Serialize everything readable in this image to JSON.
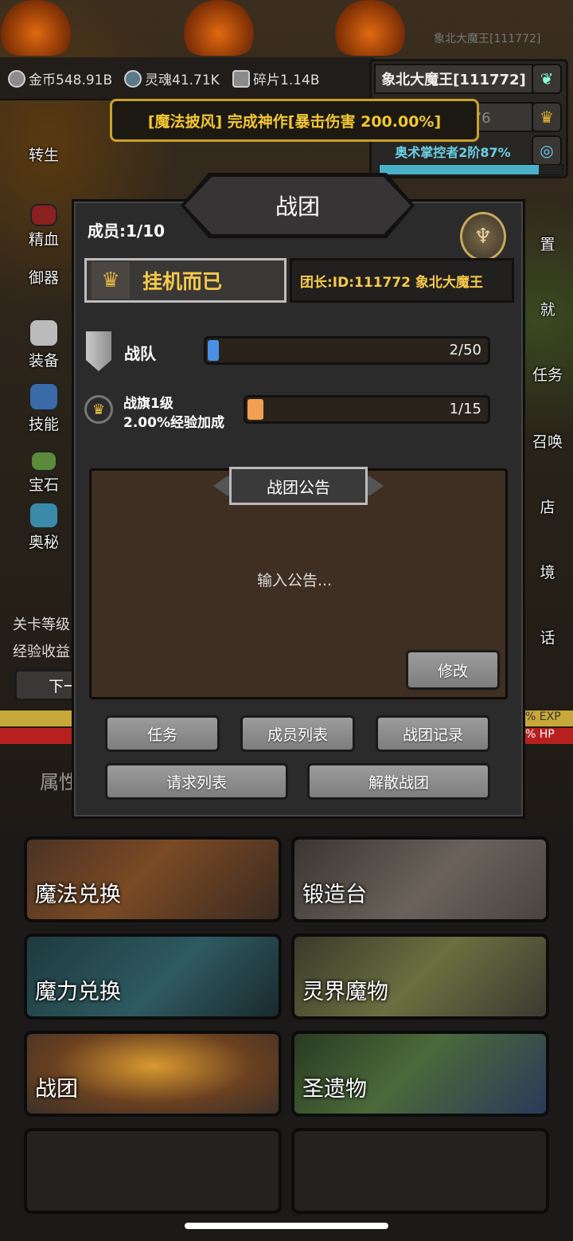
{
  "top": {
    "player_label": "象北大魔王[111772]",
    "resources": [
      {
        "icon": "gold-coin-icon",
        "label": "金币548.91B"
      },
      {
        "icon": "soul-icon",
        "label": "灵魂41.71K"
      },
      {
        "icon": "shard-icon",
        "label": "碎片1.14B"
      }
    ],
    "info_panel": {
      "name": "象北大魔王[111772]",
      "level": "等级13776",
      "skill": "奥术掌控者2阶87%",
      "skill_progress": 0.87
    }
  },
  "banner": "[魔法披风] 完成神作[暴击伤害 200.00%]",
  "left_menu": [
    "转生",
    "精血",
    "御器",
    "装备",
    "技能",
    "宝石",
    "奥秘"
  ],
  "right_menu": [
    "置",
    "就",
    "任务",
    "召唤",
    "店",
    "境",
    "话"
  ],
  "stage_info": {
    "line1": "关卡等级",
    "line2": "经验收益",
    "next": "下一",
    "exp": "% EXP",
    "hp": "% HP",
    "attr": "属性"
  },
  "dialog": {
    "title": "战团",
    "members": "成员:1/10",
    "guild_name": "挂机而已",
    "leader": "团长:ID:111772 象北大魔王",
    "squad": {
      "label": "战队",
      "value_text": "2/50",
      "progress": 0.04,
      "color": "#4b8fe6"
    },
    "flag": {
      "label": "战旗1级",
      "bonus": "2.00%经验加成",
      "value_text": "1/15",
      "progress": 0.0667,
      "color": "#f0a050"
    },
    "notice": {
      "title": "战团公告",
      "placeholder": "输入公告...",
      "edit": "修改"
    },
    "buttons": {
      "task": "任务",
      "members": "成员列表",
      "records": "战团记录",
      "requests": "请求列表",
      "disband": "解散战团"
    }
  },
  "cards": [
    "魔法兑换",
    "锻造台",
    "魔力兑换",
    "灵界魔物",
    "战团",
    "圣遗物"
  ]
}
